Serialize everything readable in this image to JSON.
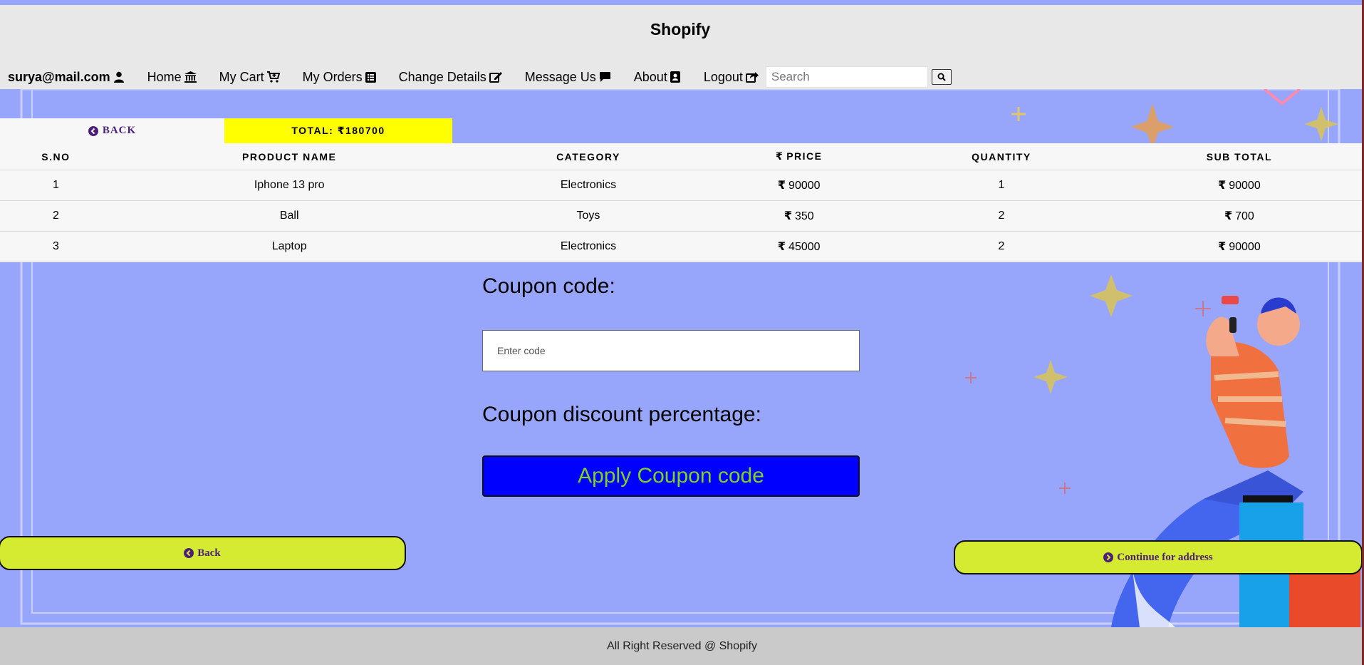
{
  "header": {
    "brand": "Shopify",
    "user_email": "surya@mail.com",
    "nav": [
      {
        "label": "Home",
        "icon": "bank-icon"
      },
      {
        "label": "My Cart",
        "icon": "cart-plus-icon"
      },
      {
        "label": "My Orders",
        "icon": "list-alt-icon"
      },
      {
        "label": "Change Details",
        "icon": "edit-icon"
      },
      {
        "label": "Message Us",
        "icon": "comment-icon"
      },
      {
        "label": "About",
        "icon": "address-book-icon"
      },
      {
        "label": "Logout",
        "icon": "share-square-icon"
      }
    ],
    "search_placeholder": "Search"
  },
  "cart": {
    "back_label": "BACK",
    "total_label": "TOTAL: ₹180700",
    "columns": [
      "S.NO",
      "PRODUCT NAME",
      "CATEGORY",
      "PRICE",
      "QUANTITY",
      "SUB TOTAL"
    ],
    "currency_symbol": "₹",
    "rows": [
      {
        "sno": "1",
        "name": "Iphone 13 pro",
        "category": "Electronics",
        "price": "90000",
        "quantity": "1",
        "subtotal": "90000"
      },
      {
        "sno": "2",
        "name": "Ball",
        "category": "Toys",
        "price": "350",
        "quantity": "2",
        "subtotal": "700"
      },
      {
        "sno": "3",
        "name": "Laptop",
        "category": "Electronics",
        "price": "45000",
        "quantity": "2",
        "subtotal": "90000"
      }
    ]
  },
  "coupon": {
    "title": "Coupon code:",
    "input_placeholder": "Enter code",
    "discount_title": "Coupon discount percentage:",
    "apply_label": "Apply Coupon code"
  },
  "actions": {
    "back_label": "Back",
    "continue_label": "Continue for address"
  },
  "footer": {
    "text": "All Right Reserved @ Shopify"
  },
  "colors": {
    "background": "#97a6fb",
    "total_highlight": "#ffff00",
    "apply_button": "#0000ff",
    "apply_text": "#7ed321",
    "pill_button": "#d4eb32",
    "link_purple": "#4b1f7a"
  }
}
